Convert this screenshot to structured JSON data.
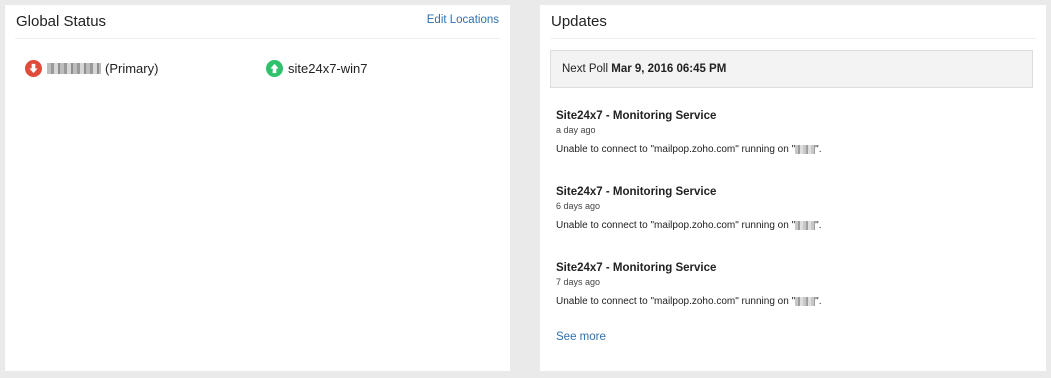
{
  "global_status": {
    "title": "Global Status",
    "edit_link": "Edit Locations",
    "locations": [
      {
        "name": "(Primary)",
        "status": "down",
        "icon": "arrow-down-icon",
        "color": "#e04b3a"
      },
      {
        "name": "site24x7-win7",
        "status": "up",
        "icon": "arrow-up-icon",
        "color": "#2dc26b"
      }
    ]
  },
  "updates": {
    "title": "Updates",
    "next_poll_label": "Next Poll",
    "next_poll_value": "Mar 9, 2016 06:45 PM",
    "items": [
      {
        "title": "Site24x7 - Monitoring Service",
        "time": "a day ago",
        "message_prefix": "Unable to connect to \"mailpop.zoho.com\" running on \"",
        "message_suffix": "\"."
      },
      {
        "title": "Site24x7 - Monitoring Service",
        "time": "6 days ago",
        "message_prefix": "Unable to connect to \"mailpop.zoho.com\" running on \"",
        "message_suffix": "\"."
      },
      {
        "title": "Site24x7 - Monitoring Service",
        "time": "7 days ago",
        "message_prefix": "Unable to connect to \"mailpop.zoho.com\" running on \"",
        "message_suffix": "\"."
      }
    ],
    "see_more": "See more"
  },
  "colors": {
    "link": "#2f6fb0",
    "down": "#e04b3a",
    "up": "#2dc26b",
    "background": "#eaeaea"
  }
}
